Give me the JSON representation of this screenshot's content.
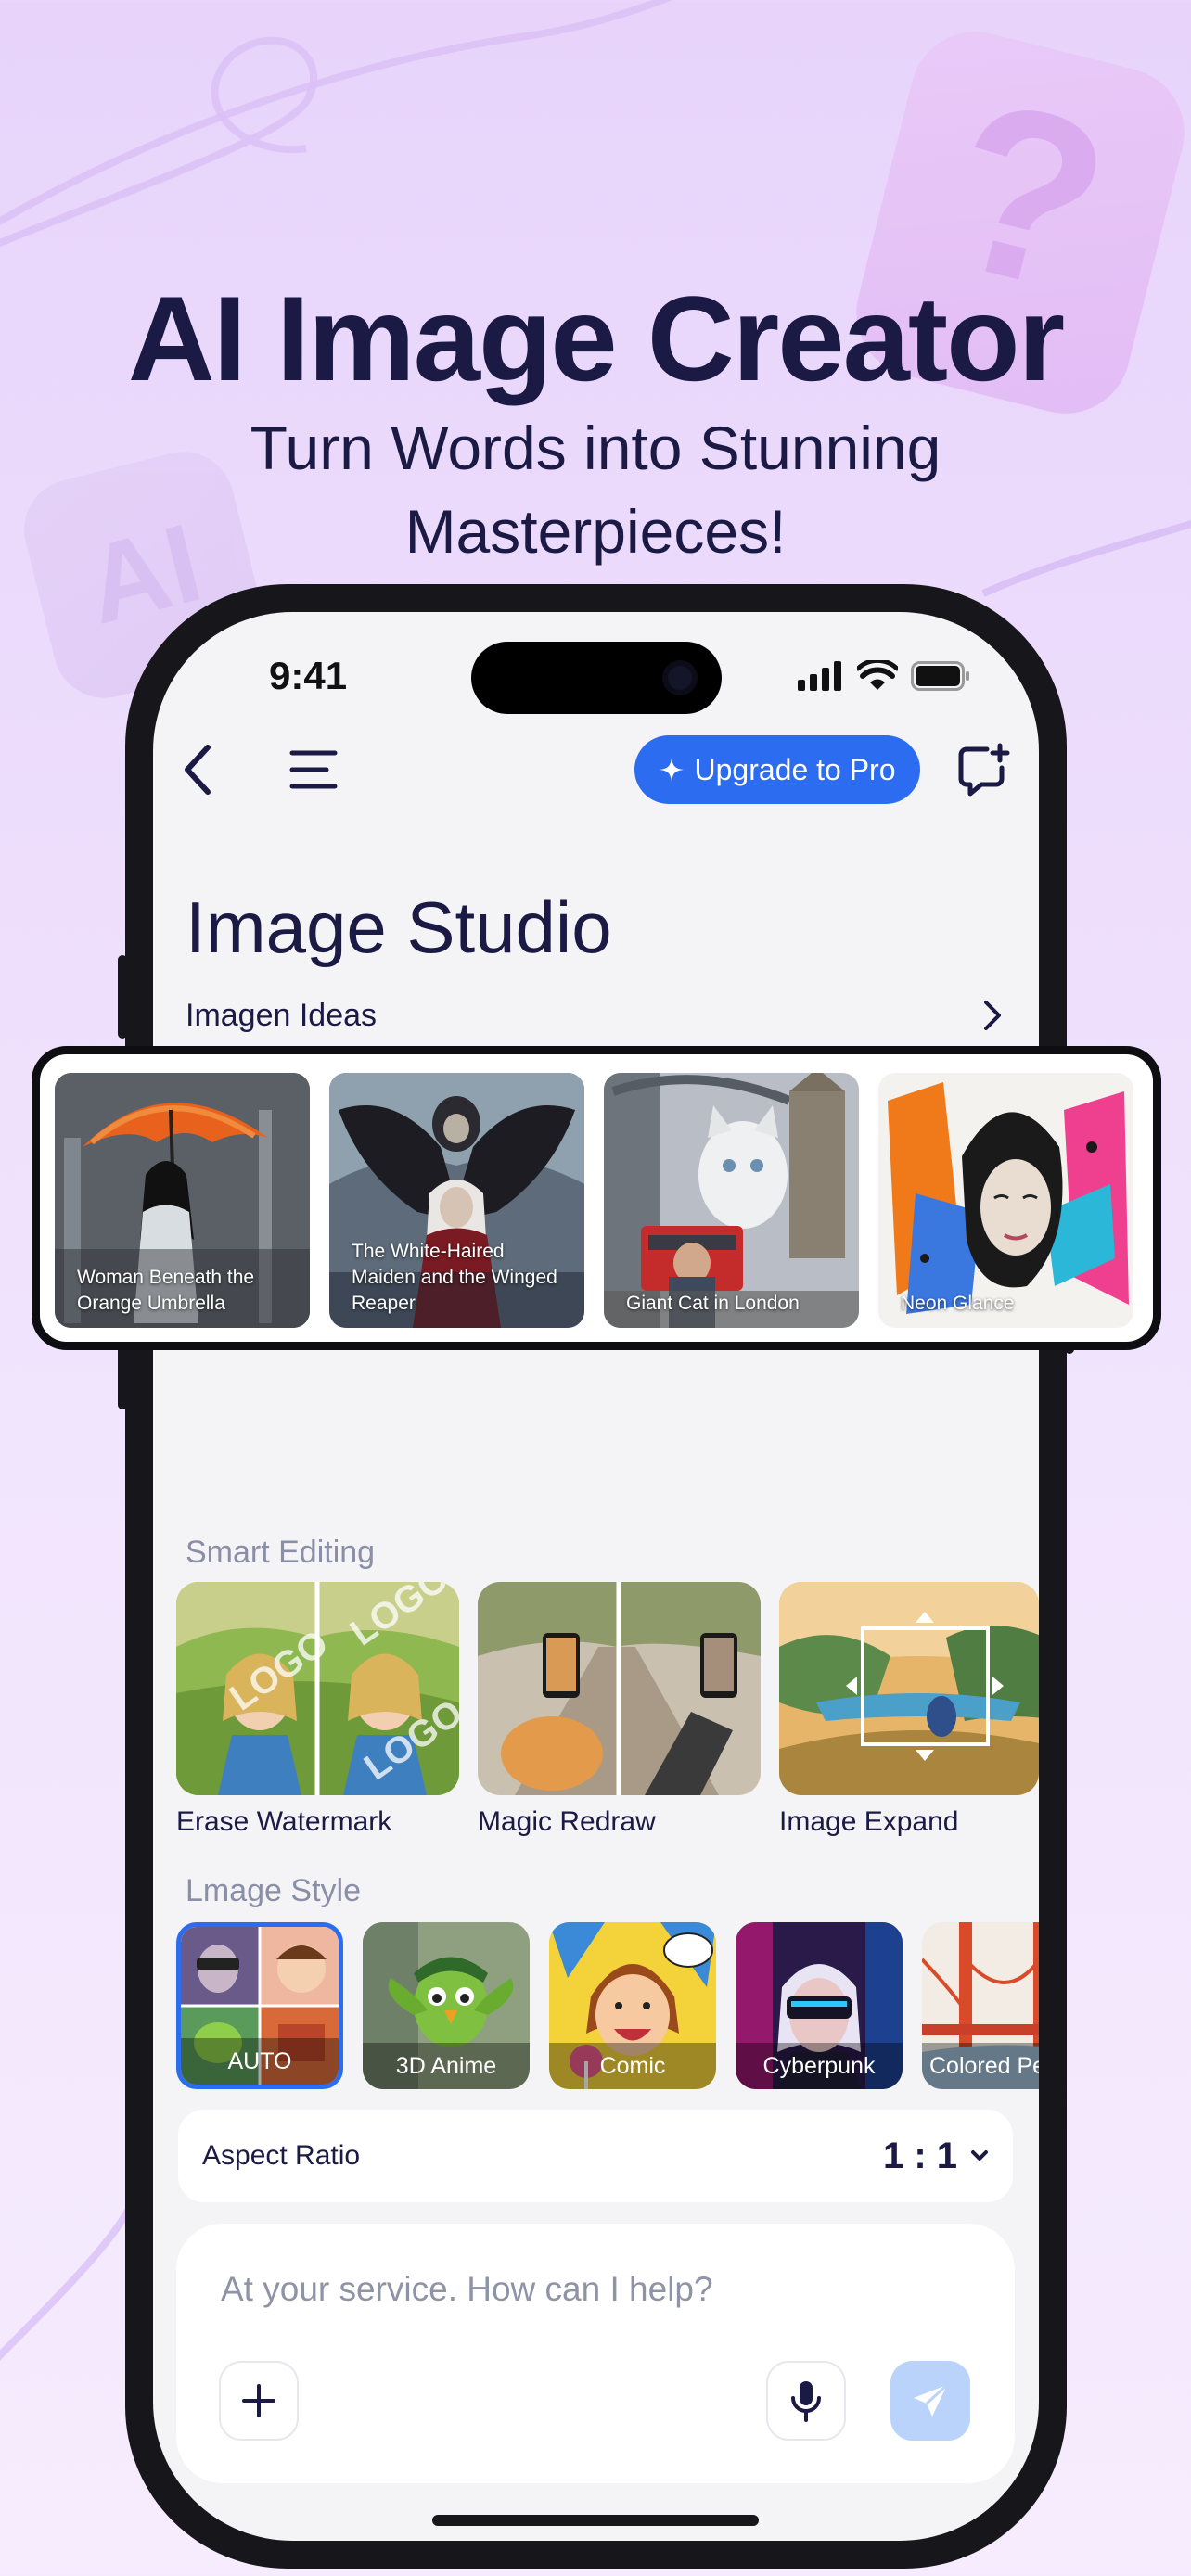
{
  "promo": {
    "headline": "AI Image Creator",
    "subline_1": "Turn Words into Stunning",
    "subline_2": "Masterpieces!"
  },
  "status_bar": {
    "time": "9:41"
  },
  "toolbar": {
    "back_icon": "chevron-left-icon",
    "menu_icon": "hamburger-menu-icon",
    "upgrade_label": "Upgrade to Pro",
    "new_chat_icon": "chat-plus-icon"
  },
  "page": {
    "title": "Image Studio",
    "ideas_label": "Imagen Ideas"
  },
  "ideas": [
    {
      "caption": "Woman Beneath the Orange Umbrella"
    },
    {
      "caption": "The White-Haired Maiden and the Winged Reaper"
    },
    {
      "caption": "Giant Cat in London"
    },
    {
      "caption": "Neon Glance"
    }
  ],
  "smart_editing": {
    "label": "Smart Editing",
    "tools": [
      {
        "label": "Erase Watermark"
      },
      {
        "label": "Magic Redraw"
      },
      {
        "label": "Image Expand"
      }
    ]
  },
  "image_style": {
    "label": "Lmage Style",
    "styles": [
      {
        "label": "AUTO",
        "selected": true
      },
      {
        "label": "3D Anime"
      },
      {
        "label": "Comic"
      },
      {
        "label": "Cyberpunk"
      },
      {
        "label": "Colored Pe"
      }
    ]
  },
  "aspect_ratio": {
    "label": "Aspect Ratio",
    "value": "1 : 1"
  },
  "composer": {
    "placeholder": "At your service. How can I help?"
  },
  "colors": {
    "accent": "#2b6cf0",
    "headline": "#1b1a45",
    "send_disabled": "#b9d3fb"
  }
}
